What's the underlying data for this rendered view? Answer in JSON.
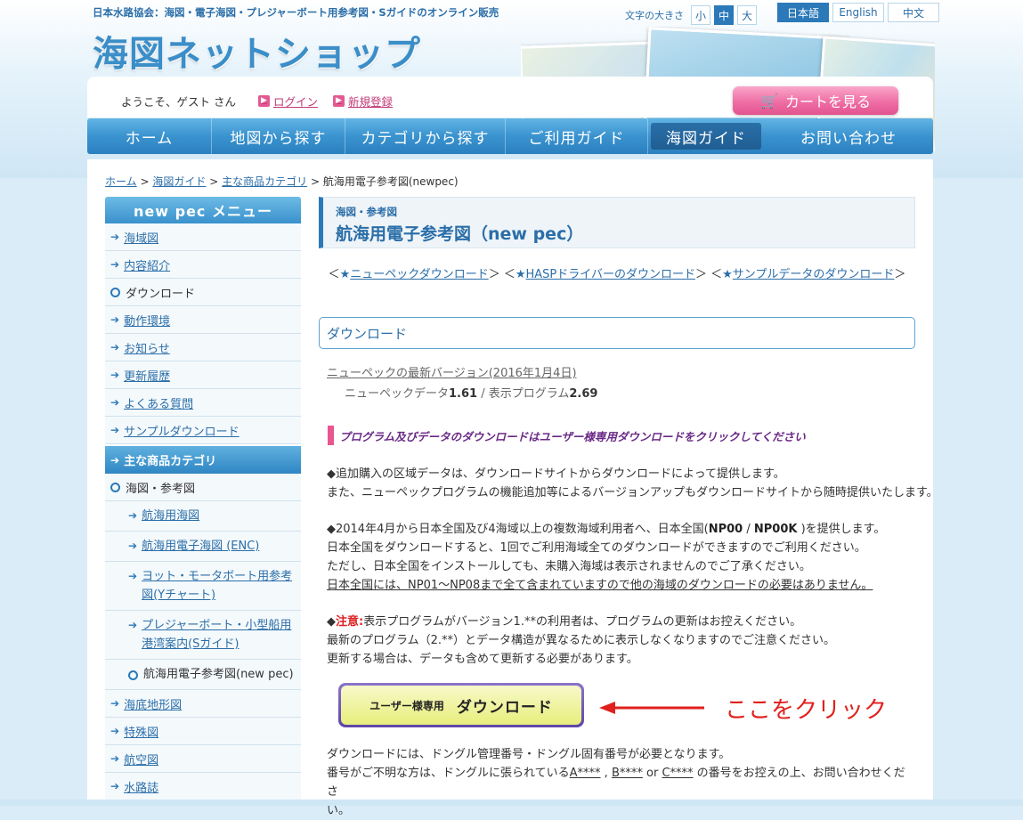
{
  "header": {
    "tagline": "日本水路協会：海図・電子海図・プレジャーボート用参考図・Sガイドのオンライン販売",
    "logo": "海図ネットショップ",
    "font_size_label": "文字の大きさ",
    "font_sizes": [
      "小",
      "中",
      "大"
    ],
    "font_size_selected": "中",
    "languages": [
      "日本語",
      "English",
      "中文"
    ],
    "language_selected": "日本語",
    "welcome": "ようこそ、ゲスト さん",
    "login": "ログイン",
    "register": "新規登録",
    "cart": "カートを見る"
  },
  "nav": {
    "items": [
      "ホーム",
      "地図から探す",
      "カテゴリから探す",
      "ご利用ガイド",
      "海図ガイド",
      "お問い合わせ"
    ],
    "active": "海図ガイド"
  },
  "breadcrumb": {
    "items": [
      "ホーム",
      "海図ガイド",
      "主な商品カテゴリ"
    ],
    "current": "航海用電子参考図(newpec)",
    "separator": ">"
  },
  "sidebar": {
    "menu_title": "new pec メニュー",
    "items": [
      "海域図",
      "内容紹介",
      "ダウンロード",
      "動作環境",
      "お知らせ",
      "更新履歴",
      "よくある質問",
      "サンプルダウンロード"
    ],
    "current": "ダウンロード",
    "category_title": "主な商品カテゴリ",
    "category_parent": "海図・参考図",
    "sub_items": [
      "航海用海図",
      "航海用電子海図 (ENC)",
      "ヨット・モータボート用参考図(Yチャート)",
      "プレジャーボート・小型船用港湾案内(Sガイド)",
      "航海用電子参考図(new pec)"
    ],
    "sub_current": "航海用電子参考図(new pec)",
    "bottom_items": [
      "海底地形図",
      "特殊図",
      "航空図",
      "水路誌"
    ]
  },
  "content": {
    "title_small": "海図・参考図",
    "title_big": "航海用電子参考図（new pec）",
    "quicklinks": [
      "ニューペックダウンロード",
      "HASPドライバーのダウンロード",
      "サンプルデータのダウンロード"
    ],
    "section_title": "ダウンロード",
    "version_link": "ニューペックの最新バージョン(2016年1月4日)",
    "version_data_label": "ニューペックデータ",
    "version_data": "1.61",
    "version_sep": " / 表示プログラム",
    "version_program": "2.69",
    "notice": "プログラム及びデータのダウンロードはユーザー様専用ダウンロードをクリックしてください",
    "p1_line1": "◆追加購入の区域データは、ダウンロードサイトからダウンロードによって提供します。",
    "p1_line2": "また、ニューペックプログラムの機能追加等によるバージョンアップもダウンロードサイトから随時提供いたします。",
    "p2_line1_a": "◆2014年4月から日本全国及び4海域以上の複数海域利用者へ、日本全国(",
    "p2_line1_b": "NP00",
    "p2_line1_c": " / ",
    "p2_line1_d": "NP00K",
    "p2_line1_e": " )を提供します。",
    "p2_line2": "日本全国をダウンロードすると、1回でご利用海域全てのダウンロードができますのでご利用ください。",
    "p2_line3": "ただし、日本全国をインストールしても、未購入海域は表示されませんのでご了承ください。",
    "p2_line4": "日本全国には、NP01〜NP08まで全て含まれていますので他の海域のダウンロードの必要はありません。",
    "p3_diamond": "◆",
    "p3_red": "注意:",
    "p3_line1": "表示プログラムがバージョン1.**の利用者は、プログラムの更新はお控えください。",
    "p3_line2": "最新のプログラム（2.**）とデータ構造が異なるために表示しなくなりますのでご注意ください。",
    "p3_line3": "更新する場合は、データも含めて更新する必要があります。",
    "dl_button_small": "ユーザー様専用",
    "dl_button_big": "ダウンロード",
    "click_here": "ここをクリック",
    "bottom_line1": "ダウンロードには、ドングル管理番号・ドングル固有番号が必要となります。",
    "bottom_line2_a": "番号がご不明な方は、ドングルに張られている",
    "bottom_code_a": "A****",
    "bottom_comma": " , ",
    "bottom_code_b": "B****",
    "bottom_or": " or ",
    "bottom_code_c": "C****",
    "bottom_line2_b": " の番号をお控えの上、お問い合わせくださ",
    "bottom_line3": "い。"
  },
  "colors": {
    "accent": "#2b79b8",
    "link": "#2b6ea8",
    "pink": "#e35a93",
    "red": "#e0201c",
    "notice_text": "#6a2a86"
  }
}
